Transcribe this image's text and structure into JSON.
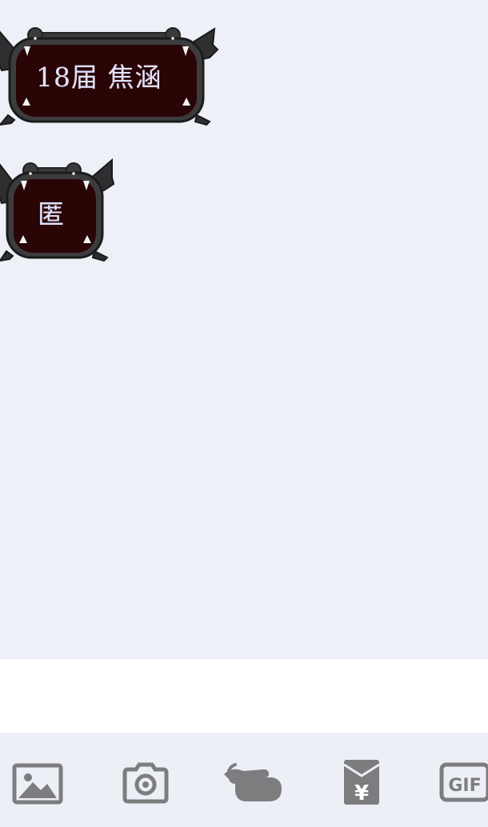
{
  "messages": [
    {
      "text": "18届 焦涵"
    },
    {
      "text": "匿"
    }
  ],
  "input": {
    "value": ""
  },
  "toolbar": {
    "items": [
      {
        "icon": "image-icon"
      },
      {
        "icon": "camera-icon"
      },
      {
        "icon": "poke-hand-icon"
      },
      {
        "icon": "red-packet-icon",
        "symbol": "¥"
      },
      {
        "icon": "gif-icon",
        "label": "GIF"
      }
    ]
  },
  "colors": {
    "chat_background": "#edf0f6",
    "bubble_fill": "#2a0506",
    "bubble_border": "#3a3a3a",
    "bubble_text": "#dfe3ff",
    "icon_gray": "#7d7d80"
  }
}
